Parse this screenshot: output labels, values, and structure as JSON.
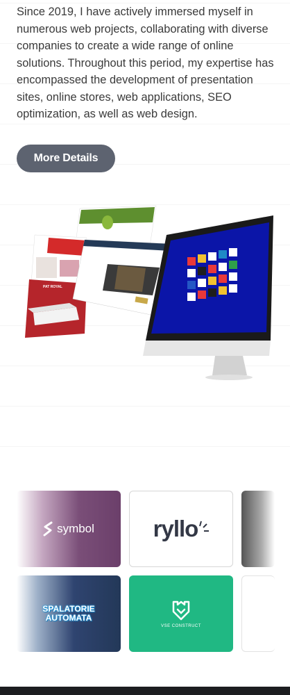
{
  "intro": {
    "text": "Since 2019, I have actively immersed myself in numerous web projects, collaborating with diverse companies to create a wide range of online solutions. Throughout this period, my expertise has encompassed the development of presentation sites, online stores, web applications, SEO optimization, as well as web design."
  },
  "cta": {
    "label": "More Details"
  },
  "hero": {
    "pat_royal_label": "PAT ROYAL",
    "icon": "devices-mockup-illustration"
  },
  "clients": [
    {
      "name": "symbol",
      "label": "symbol"
    },
    {
      "name": "ryllo",
      "label": "ryllo"
    },
    {
      "name": "partial-logo"
    },
    {
      "name": "spalatorie-automata",
      "label_line1": "SPALATORIE",
      "label_line2": "AUTOMATA"
    },
    {
      "name": "vse-construct",
      "label": "VSE CONSTRUCT"
    },
    {
      "name": "partial-logo-2"
    }
  ],
  "colors": {
    "cta_bg": "#5d6370",
    "text": "#3a3a3a",
    "vse_green": "#20b883",
    "symbol_purple": "#6b3f6a",
    "spal_navy": "#233858"
  }
}
